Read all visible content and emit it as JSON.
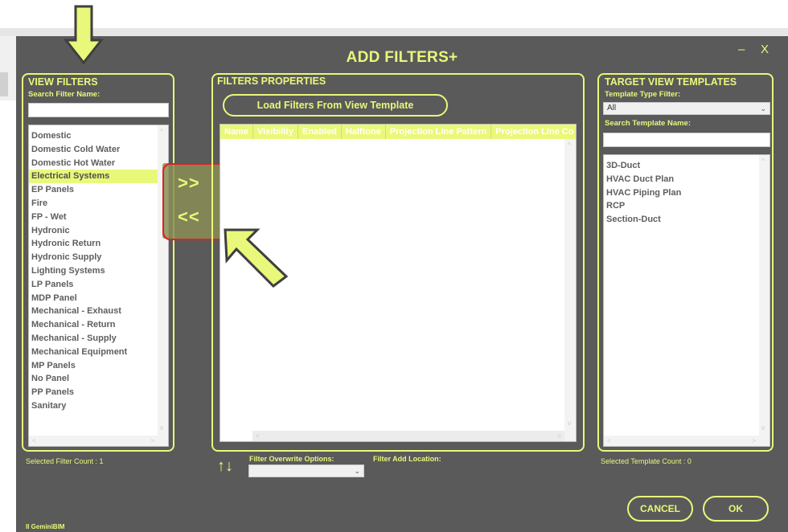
{
  "window": {
    "title": "ADD FILTERS+",
    "minimize_glyph": "–",
    "close_glyph": "X",
    "brand": "II GeminiBIM"
  },
  "left_panel": {
    "title": "VIEW FILTERS",
    "search_label": "Search Filter Name:",
    "search_value": "",
    "items": [
      "Domestic",
      "Domestic Cold Water",
      "Domestic Hot Water",
      "Electrical Systems",
      "EP Panels",
      "Fire",
      "FP - Wet",
      "Hydronic",
      "Hydronic Return",
      "Hydronic Supply",
      "Lighting Systems",
      "LP Panels",
      "MDP Panel",
      "Mechanical - Exhaust",
      "Mechanical - Return",
      "Mechanical - Supply",
      "Mechanical Equipment",
      "MP Panels",
      "No Panel",
      "PP Panels",
      "Sanitary"
    ],
    "selected_item": "Electrical Systems",
    "count_text": "Selected Filter Count : 1"
  },
  "transfer": {
    "add_label": ">>",
    "remove_label": "<<"
  },
  "middle_panel": {
    "title": "FILTERS PROPERTIES",
    "load_button": "Load Filters From View Template",
    "columns": [
      "Name",
      "Visibility",
      "Enabled",
      "Halftone",
      "Projection Line Pattern",
      "Projection Line Co"
    ],
    "reorder_glyph": "↑↓",
    "overwrite_label": "Filter Overwrite Options:",
    "overwrite_value": "",
    "location_label": "Filter Add Location:"
  },
  "right_panel": {
    "title": "TARGET VIEW TEMPLATES",
    "type_filter_label": "Template Type Filter:",
    "type_filter_value": "All",
    "search_label": "Search Template Name:",
    "search_value": "",
    "items": [
      "3D-Duct",
      "HVAC Duct Plan",
      "HVAC Piping Plan",
      "RCP",
      "Section-Duct"
    ],
    "count_text": "Selected Template Count : 0"
  },
  "actions": {
    "cancel_label": "CANCEL",
    "ok_label": "OK"
  },
  "colors": {
    "accent": "#e9f77a",
    "window_bg": "#5a5a5a",
    "highlight_box": "#e02020",
    "annotation_arrow": "#e9f77a"
  },
  "annotations": {
    "arrow_icons": [
      "down-arrow-annotation-icon",
      "pointer-arrow-annotation-icon"
    ]
  }
}
